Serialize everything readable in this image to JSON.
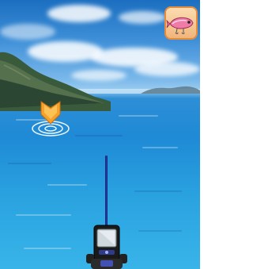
{
  "scene": {
    "name": "fishing-ocean-view",
    "colors": {
      "sky_top": "#1c6fc0",
      "sea_main": "#2aa3e0",
      "marker_orange": "#f6a12a",
      "marker_ring": "#ffffff",
      "rod_blue": "#2b3fb0",
      "lure_bg": "#f1b57b",
      "lure_border": "#e58b3c"
    }
  },
  "hud": {
    "lure_button_icon": "lure-fish-icon"
  },
  "cast_marker": {
    "icon": "chevron-down-target-icon"
  },
  "rod": {
    "icon": "fishing-rod-icon",
    "reel_icon": "reel-handle-icon",
    "screen_icon": "fish-finder-screen-icon"
  }
}
